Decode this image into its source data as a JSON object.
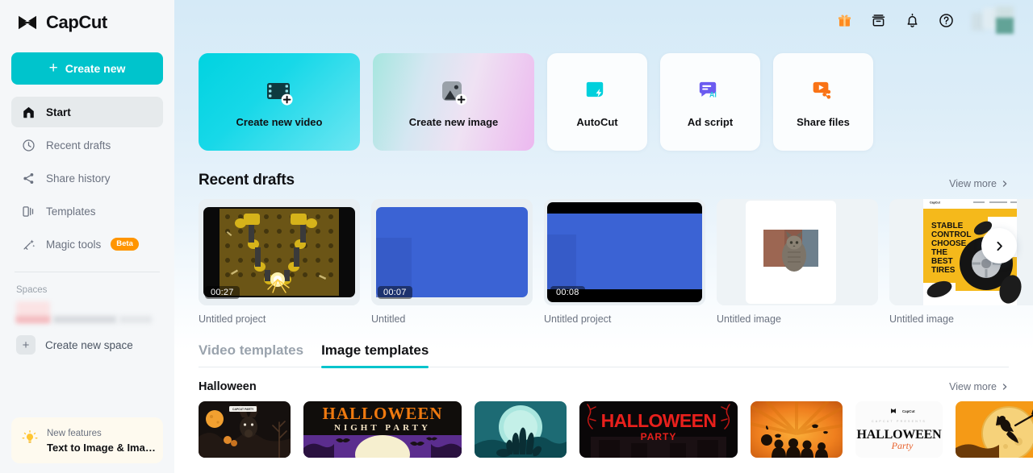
{
  "brand": {
    "name": "CapCut",
    "logo_icon": "capcut-logo-icon"
  },
  "sidebar": {
    "create_new_label": "Create new",
    "items": [
      {
        "label": "Start",
        "icon": "home-icon",
        "active": true
      },
      {
        "label": "Recent drafts",
        "icon": "clock-icon",
        "active": false
      },
      {
        "label": "Share history",
        "icon": "share-icon",
        "active": false
      },
      {
        "label": "Templates",
        "icon": "templates-icon",
        "active": false
      },
      {
        "label": "Magic tools",
        "icon": "magic-wand-icon",
        "active": false,
        "badge": "Beta"
      }
    ],
    "spaces_label": "Spaces",
    "create_space_label": "Create new space",
    "new_features": {
      "title": "New features",
      "subtitle": "Text to Image & Ima…",
      "icon": "lightbulb-icon"
    }
  },
  "header": {
    "icons": [
      {
        "name": "gift-icon"
      },
      {
        "name": "archive-box-icon"
      },
      {
        "name": "bell-icon"
      },
      {
        "name": "help-circle-icon"
      }
    ],
    "avatar": "avatar-blurred"
  },
  "action_cards": [
    {
      "label": "Create new video",
      "icon": "film-strip-plus-icon",
      "size": "large",
      "style": "video"
    },
    {
      "label": "Create new image",
      "icon": "image-plus-icon",
      "size": "large",
      "style": "image"
    },
    {
      "label": "AutoCut",
      "icon": "autocut-icon",
      "size": "small",
      "style": "plain"
    },
    {
      "label": "Ad script",
      "icon": "ad-script-ai-icon",
      "size": "small",
      "style": "plain"
    },
    {
      "label": "Share files",
      "icon": "share-files-icon",
      "size": "small",
      "style": "plain"
    }
  ],
  "recent_drafts": {
    "title": "Recent drafts",
    "view_more": "View more",
    "next_icon": "chevron-right-icon",
    "items": [
      {
        "name": "Untitled project",
        "duration": "00:27",
        "thumb": "machinery-sparks-thumb"
      },
      {
        "name": "Untitled",
        "duration": "00:07",
        "thumb": "blue-blank-thumb"
      },
      {
        "name": "Untitled project",
        "duration": "00:08",
        "thumb": "blue-letterbox-thumb"
      },
      {
        "name": "Untitled image",
        "duration": "",
        "thumb": "cat-photo-thumb"
      },
      {
        "name": "Untitled image",
        "duration": "",
        "thumb": "tire-poster-thumb"
      }
    ]
  },
  "templates": {
    "tabs": [
      {
        "label": "Video templates",
        "active": false
      },
      {
        "label": "Image templates",
        "active": true
      }
    ],
    "category": "Halloween",
    "view_more": "View more",
    "items": [
      {
        "name": "halloween-moon-deer-template",
        "caption": "CAPCUT PARTY"
      },
      {
        "name": "halloween-night-party-template",
        "caption": "HALLOWEEN",
        "caption2": "NIGHT PARTY"
      },
      {
        "name": "halloween-zombie-hand-template",
        "caption": ""
      },
      {
        "name": "halloween-party-red-template",
        "caption": "HALLOWEEN",
        "caption2": "PARTY"
      },
      {
        "name": "halloween-kids-orange-template",
        "caption": ""
      },
      {
        "name": "halloween-party-white-template",
        "caption": "HALLOWEEN",
        "caption2": "Party",
        "caption3": "CapCut",
        "caption4": "CAPCUT PRESENTS"
      },
      {
        "name": "halloween-witch-moon-template",
        "caption": ""
      }
    ]
  },
  "colors": {
    "accent": "#00c4cc",
    "beta_badge": "#ff9500",
    "sidebar_bg": "#f5f7f9",
    "main_bg_top": "#d5eaf7"
  }
}
